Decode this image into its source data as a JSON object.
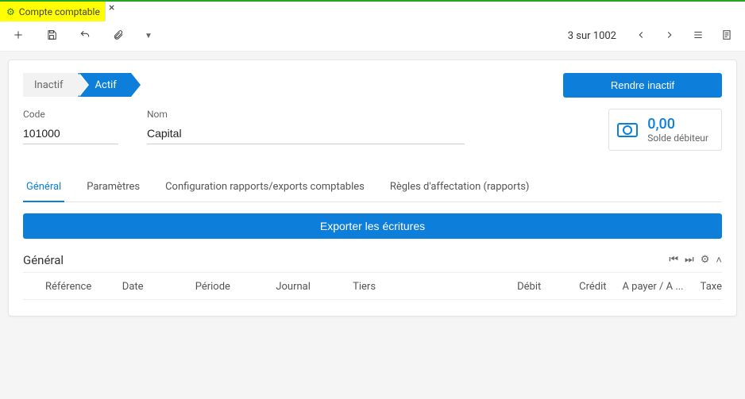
{
  "tab": {
    "title": "Compte comptable"
  },
  "pager": {
    "current": 3,
    "total": 1002,
    "sep": "sur"
  },
  "status": {
    "inactive": "Inactif",
    "active": "Actif"
  },
  "action_button": "Rendre inactif",
  "fields": {
    "code_label": "Code",
    "code_value": "101000",
    "nom_label": "Nom",
    "nom_value": "Capital"
  },
  "balance": {
    "amount": "0,00",
    "label": "Solde débiteur"
  },
  "tabs": {
    "general": "Général",
    "parametres": "Paramètres",
    "config": "Configuration rapports/exports comptables",
    "regles": "Règles d'affectation (rapports)"
  },
  "export_button": "Exporter les écritures",
  "section": {
    "title": "Général"
  },
  "columns": {
    "reference": "Référence",
    "date": "Date",
    "periode": "Période",
    "journal": "Journal",
    "tiers": "Tiers",
    "debit": "Débit",
    "credit": "Crédit",
    "apayer": "A payer / A ...",
    "taxe": "Taxe"
  }
}
